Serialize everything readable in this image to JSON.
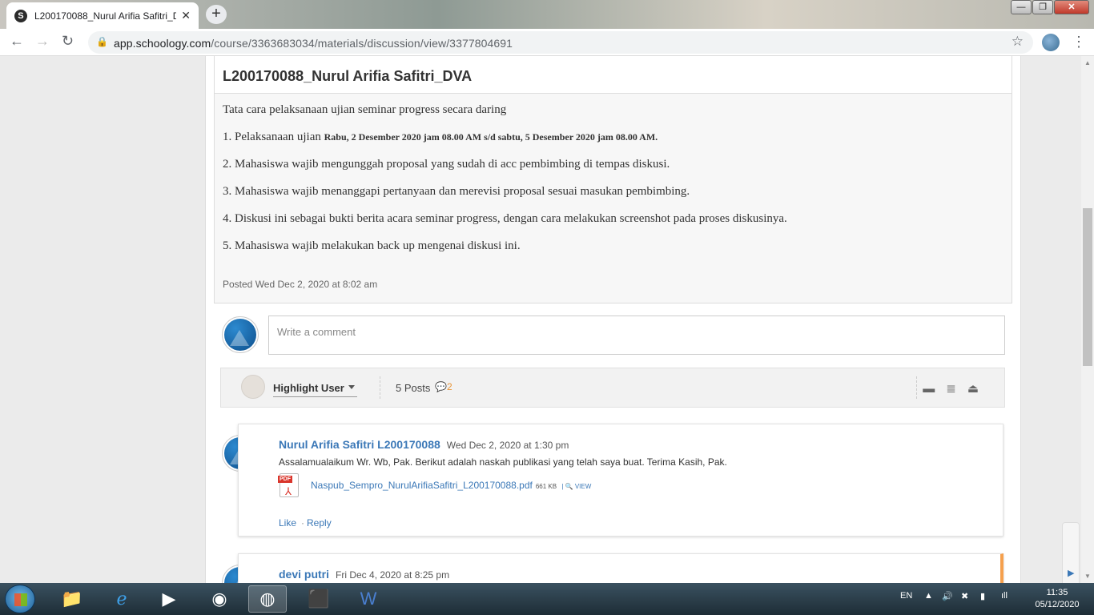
{
  "browser": {
    "tab_title": "L200170088_Nurul Arifia Safitri_DVA",
    "tab_favicon": "S",
    "tab_close": "✕",
    "new_tab": "+",
    "url_host": "app.schoology.com",
    "url_path": "/course/3363683034/materials/discussion/view/3377804691",
    "window_controls": {
      "minimize": "—",
      "maximize": "❐",
      "close": "✕"
    }
  },
  "post": {
    "title": "L200170088_Nurul Arifia Safitri_DVA",
    "intro": "Tata cara pelaksanaan ujian seminar progress secara daring",
    "item1_text": "1. Pelaksanaan ujian ",
    "item1_bold": "Rabu, 2 Desember 2020 jam 08.00 AM s/d sabtu, 5 Desember 2020 jam 08.00 AM.",
    "item2": "2. Mahasiswa wajib mengunggah proposal yang sudah di acc pembimbing di tempas diskusi.",
    "item3": "3. Mahasiswa wajib menanggapi pertanyaan dan merevisi proposal sesuai masukan pembimbing.",
    "item4": "4. Diskusi ini sebagai bukti berita acara seminar progress, dengan cara melakukan screenshot pada proses diskusinya.",
    "item5": "5. Mahasiswa wajib melakukan back up mengenai diskusi ini.",
    "posted": "Posted Wed Dec 2, 2020 at 8:02 am"
  },
  "comment_input": {
    "placeholder": "Write a comment"
  },
  "controls": {
    "highlight_user": "Highlight User",
    "posts_count": "5 Posts",
    "comments_count": "2"
  },
  "replies": [
    {
      "author": "Nurul Arifia Safitri L200170088",
      "date": "Wed Dec 2, 2020 at 1:30 pm",
      "text": "Assalamualaikum Wr. Wb, Pak. Berikut adalah naskah publikasi yang telah saya buat. Terima Kasih, Pak.",
      "file_name": "Naspub_Sempro_NurulArifiaSafitri_L200170088.pdf",
      "file_size": "661 KB",
      "file_view": "VIEW",
      "like": "Like",
      "reply": "Reply"
    },
    {
      "author": "devi putri",
      "date": "Fri Dec 4, 2020 at 8:25 pm"
    }
  ],
  "schoology_button": "S",
  "taskbar": {
    "lang": "EN",
    "time": "11:35",
    "date": "05/12/2020"
  }
}
